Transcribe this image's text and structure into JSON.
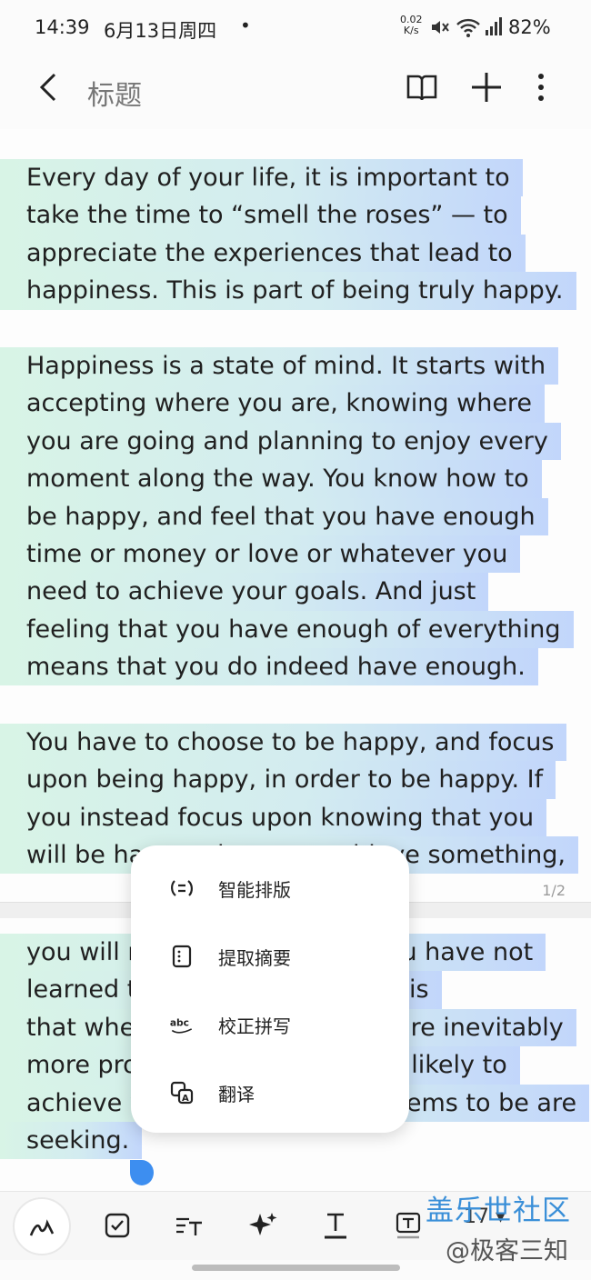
{
  "status": {
    "time": "14:39",
    "date": "6月13日周四",
    "dot": "•",
    "net_speed_value": "0.02",
    "net_speed_unit": "K/s",
    "battery": "82%",
    "icons": [
      "mute-icon",
      "wifi-icon",
      "signal-icon"
    ]
  },
  "header": {
    "title": "标题",
    "icons": [
      "back-icon",
      "book-icon",
      "add-icon",
      "more-icon"
    ]
  },
  "note": {
    "page1_lines": [
      "Every day of your life, it is important to",
      "take the time to “smell the roses” — to",
      "appreciate the experiences that lead to",
      "happiness. This is part of being truly happy.",
      "",
      "Happiness is a state of mind. It starts with",
      "accepting where you are, knowing where",
      "you are going and planning to enjoy every",
      "moment along the way. You know how to",
      "be happy, and feel that you have enough",
      "time or money or love or whatever you",
      "need to achieve your goals. And just",
      "feeling that you have enough of everything",
      "means that you do indeed have enough.",
      "",
      "You have to choose to be happy, and focus",
      "upon being happy, in order to be happy. If",
      "you instead focus upon knowing that you",
      "will be happy when you achieve something,"
    ],
    "page2_lines": [
      "you will never be happy, as you have not",
      "learned to be happy. The irony is",
      "that when you are happy you are inevitably",
      "more productive, and far more likely to",
      "achieve what everyone else seems to be are",
      "seeking."
    ],
    "page_indicator": "1/2"
  },
  "menu": {
    "items": [
      {
        "label": "智能排版",
        "icon": "smart-layout-icon"
      },
      {
        "label": "提取摘要",
        "icon": "summary-icon"
      },
      {
        "label": "校正拼写",
        "icon": "spell-check-icon"
      },
      {
        "label": "翻译",
        "icon": "translate-icon"
      }
    ]
  },
  "toolbar": {
    "items": [
      "pen-icon",
      "checkbox-icon",
      "text-style-icon",
      "ai-sparkle-icon",
      "text-color-icon",
      "text-box-icon"
    ],
    "font_size": "17 ▾"
  },
  "watermark": {
    "line1": "盖乐世社区",
    "line2": "@极客三知"
  },
  "colors": {
    "highlight_start": "#d8f4e6",
    "highlight_end": "#c2d6fb",
    "cursor": "#3d8ef0"
  }
}
